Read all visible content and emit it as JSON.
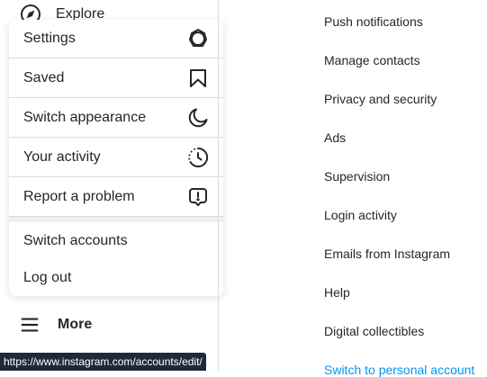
{
  "nav": {
    "explore_label": "Explore",
    "more_label": "More"
  },
  "more_menu": {
    "items": [
      {
        "label": "Settings",
        "icon": "settings-icon"
      },
      {
        "label": "Saved",
        "icon": "bookmark-icon"
      },
      {
        "label": "Switch appearance",
        "icon": "moon-icon"
      },
      {
        "label": "Your activity",
        "icon": "activity-icon"
      },
      {
        "label": "Report a problem",
        "icon": "report-icon"
      }
    ],
    "switch_accounts_label": "Switch accounts",
    "log_out_label": "Log out"
  },
  "settings": {
    "items": [
      "Push notifications",
      "Manage contacts",
      "Privacy and security",
      "Ads",
      "Supervision",
      "Login activity",
      "Emails from Instagram",
      "Help",
      "Digital collectibles"
    ],
    "switch_account_link": "Switch to personal account"
  },
  "status_bar": {
    "url": "https://www.instagram.com/accounts/edit/"
  },
  "colors": {
    "link": "#0095f6",
    "text": "#262626",
    "divider": "#dbdbdb"
  }
}
